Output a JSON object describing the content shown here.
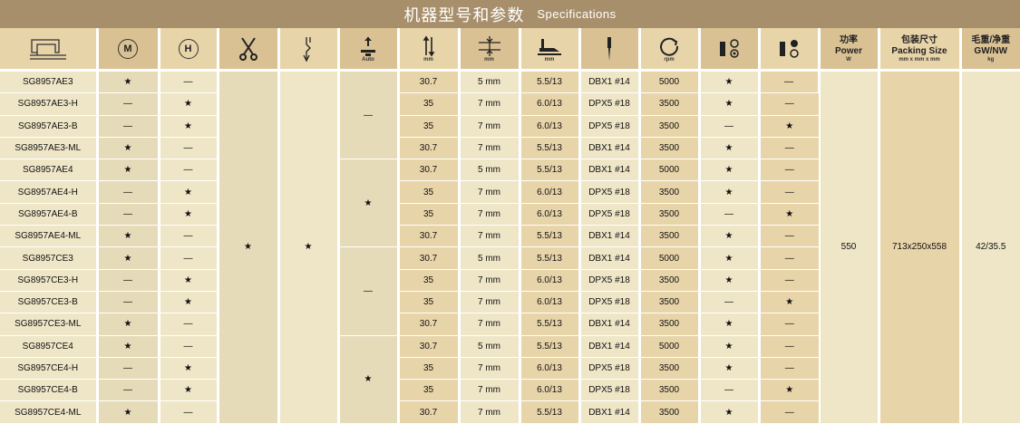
{
  "title_cn": "机器型号和参数",
  "title_en": "Specifications",
  "headers": {
    "motor_letter": "M",
    "head_letter": "H",
    "autofoot_unit": "Auto",
    "needle_unit": "mm",
    "stitch_unit": "mm",
    "presser_unit": "mm",
    "speed_unit": "rpm",
    "power_cn": "功率",
    "power_en": "Power",
    "power_unit": "W",
    "pack_cn": "包装尺寸",
    "pack_en": "Packing Size",
    "pack_unit": "mm x mm x mm",
    "gw_cn": "毛重/净重",
    "gw_en": "GW/NW",
    "gw_unit": "kg"
  },
  "merged": {
    "lt_star": "★",
    "uw_star": "★",
    "af_groups": [
      "—",
      "★",
      "—",
      "★"
    ],
    "power": "550",
    "packing": "713x250x558",
    "gwnw": "42/35.5"
  },
  "rows": [
    [
      "SG8957AE3",
      "★",
      "—",
      "30.7",
      "5 mm",
      "5.5/13",
      "DBX1 #14",
      "5000",
      "★",
      "—"
    ],
    [
      "SG8957AE3-H",
      "—",
      "★",
      "35",
      "7 mm",
      "6.0/13",
      "DPX5 #18",
      "3500",
      "★",
      "—"
    ],
    [
      "SG8957AE3-B",
      "—",
      "★",
      "35",
      "7 mm",
      "6.0/13",
      "DPX5 #18",
      "3500",
      "—",
      "★"
    ],
    [
      "SG8957AE3-ML",
      "★",
      "—",
      "30.7",
      "7 mm",
      "5.5/13",
      "DBX1 #14",
      "3500",
      "★",
      "—"
    ],
    [
      "SG8957AE4",
      "★",
      "—",
      "30.7",
      "5 mm",
      "5.5/13",
      "DBX1 #14",
      "5000",
      "★",
      "—"
    ],
    [
      "SG8957AE4-H",
      "—",
      "★",
      "35",
      "7 mm",
      "6.0/13",
      "DPX5 #18",
      "3500",
      "★",
      "—"
    ],
    [
      "SG8957AE4-B",
      "—",
      "★",
      "35",
      "7 mm",
      "6.0/13",
      "DPX5 #18",
      "3500",
      "—",
      "★"
    ],
    [
      "SG8957AE4-ML",
      "★",
      "—",
      "30.7",
      "7 mm",
      "5.5/13",
      "DBX1 #14",
      "3500",
      "★",
      "—"
    ],
    [
      "SG8957CE3",
      "★",
      "—",
      "30.7",
      "5 mm",
      "5.5/13",
      "DBX1 #14",
      "5000",
      "★",
      "—"
    ],
    [
      "SG8957CE3-H",
      "—",
      "★",
      "35",
      "7 mm",
      "6.0/13",
      "DPX5 #18",
      "3500",
      "★",
      "—"
    ],
    [
      "SG8957CE3-B",
      "—",
      "★",
      "35",
      "7 mm",
      "6.0/13",
      "DPX5 #18",
      "3500",
      "—",
      "★"
    ],
    [
      "SG8957CE3-ML",
      "★",
      "—",
      "30.7",
      "7 mm",
      "5.5/13",
      "DBX1 #14",
      "3500",
      "★",
      "—"
    ],
    [
      "SG8957CE4",
      "★",
      "—",
      "30.7",
      "5 mm",
      "5.5/13",
      "DBX1 #14",
      "5000",
      "★",
      "—"
    ],
    [
      "SG8957CE4-H",
      "—",
      "★",
      "35",
      "7 mm",
      "6.0/13",
      "DPX5 #18",
      "3500",
      "★",
      "—"
    ],
    [
      "SG8957CE4-B",
      "—",
      "★",
      "35",
      "7 mm",
      "6.0/13",
      "DPX5 #18",
      "3500",
      "—",
      "★"
    ],
    [
      "SG8957CE4-ML",
      "★",
      "—",
      "30.7",
      "7 mm",
      "5.5/13",
      "DBX1 #14",
      "3500",
      "★",
      "—"
    ]
  ]
}
